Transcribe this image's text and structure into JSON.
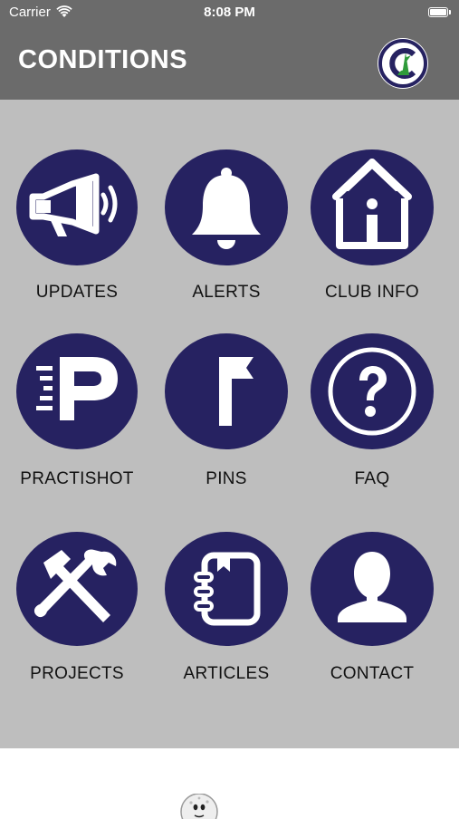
{
  "status_bar": {
    "carrier": "Carrier",
    "time": "8:08 PM",
    "wifi_icon": "wifi-icon",
    "battery_icon": "battery-icon"
  },
  "header": {
    "title": "CONDITIONS",
    "logo_icon": "club-logo"
  },
  "colors": {
    "header_bg": "#6b6b6b",
    "grid_bg": "#bebebe",
    "icon_circle": "#262261",
    "label_text": "#111111",
    "logo_green": "#2e9a3a"
  },
  "menu": [
    {
      "label": "UPDATES",
      "icon": "megaphone-icon"
    },
    {
      "label": "ALERTS",
      "icon": "bell-icon"
    },
    {
      "label": "CLUB INFO",
      "icon": "house-info-icon"
    },
    {
      "label": "PRACTISHOT",
      "icon": "practishot-p-icon"
    },
    {
      "label": "PINS",
      "icon": "flag-pin-icon"
    },
    {
      "label": "FAQ",
      "icon": "question-icon"
    },
    {
      "label": "PROJECTS",
      "icon": "tools-icon"
    },
    {
      "label": "ARTICLES",
      "icon": "notebook-icon"
    },
    {
      "label": "CONTACT",
      "icon": "person-icon"
    }
  ]
}
